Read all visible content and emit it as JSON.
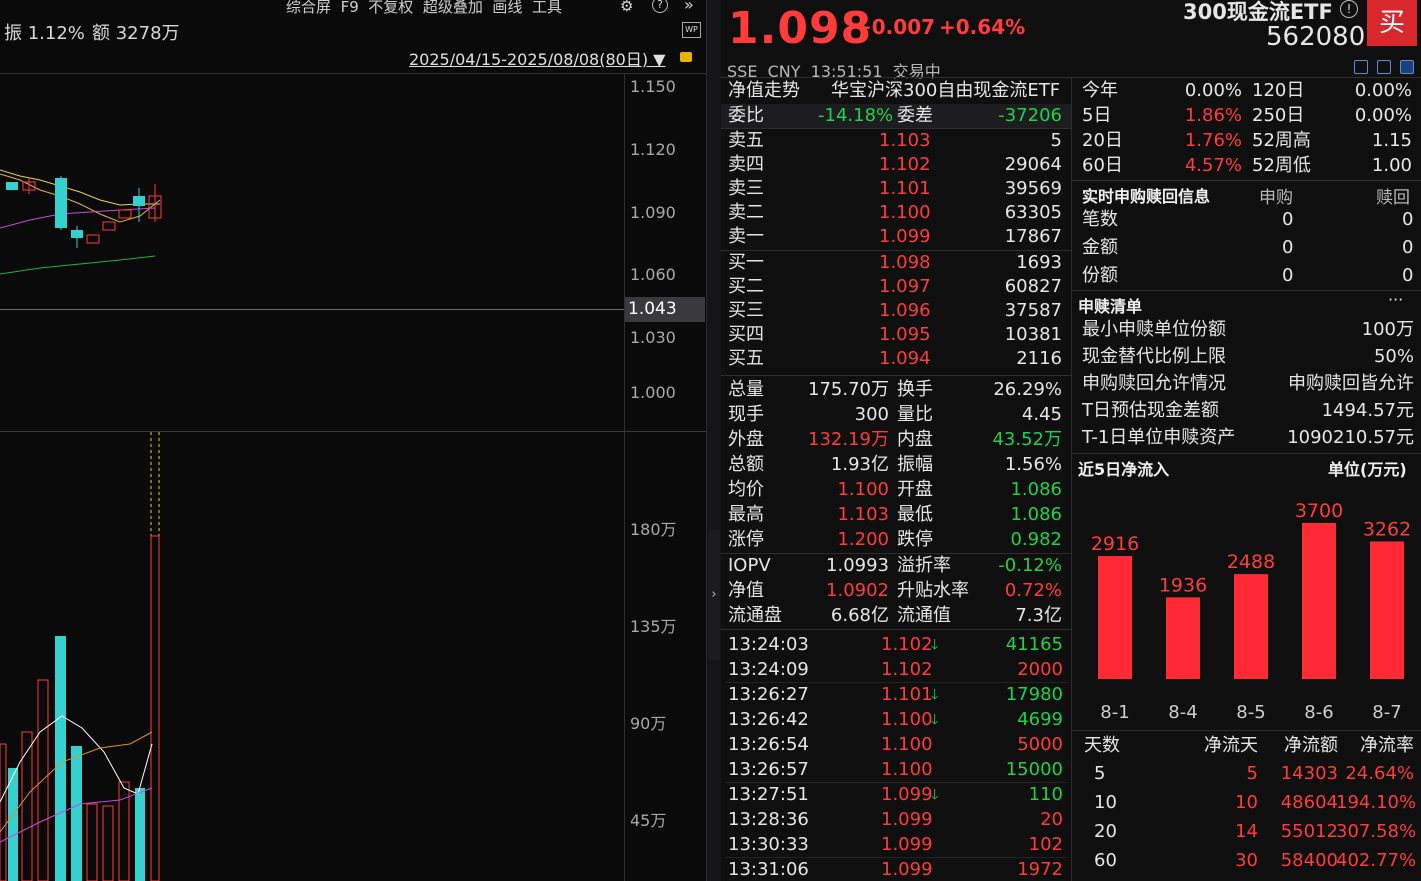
{
  "toolbar": {
    "items": [
      "综合屏",
      "F9",
      "不复权",
      "超级叠加",
      "画线",
      "工具"
    ],
    "amplitude": "振 1.12%",
    "amount": "额 3278万",
    "date_range": "2025/04/15-2025/08/08(80日)",
    "wp_label": "WP"
  },
  "price_axis": [
    "1.150",
    "1.120",
    "1.090",
    "1.060",
    "1.030",
    "1.000"
  ],
  "cursor_price": "1.043",
  "volume_axis": [
    "180万",
    "135万",
    "90万",
    "45万"
  ],
  "quote": {
    "price": "1.098",
    "change": "+0.007",
    "change_pct": "+0.64%",
    "name": "300现金流ETF",
    "code": "562080",
    "buy_label": "买",
    "exchange_line": "SSE  CNY  13:51:51  交易中"
  },
  "order_book": {
    "nav_trend_label": "净值走势",
    "fund_name": "华宝沪深300自由现金流ETF",
    "weibi_label": "委比",
    "weibi": "-14.18%",
    "weicha_label": "委差",
    "weicha": "-37206",
    "asks": [
      {
        "label": "卖五",
        "price": "1.103",
        "vol": "5"
      },
      {
        "label": "卖四",
        "price": "1.102",
        "vol": "29064"
      },
      {
        "label": "卖三",
        "price": "1.101",
        "vol": "39569"
      },
      {
        "label": "卖二",
        "price": "1.100",
        "vol": "63305"
      },
      {
        "label": "卖一",
        "price": "1.099",
        "vol": "17867"
      }
    ],
    "bids": [
      {
        "label": "买一",
        "price": "1.098",
        "vol": "1693"
      },
      {
        "label": "买二",
        "price": "1.097",
        "vol": "60827"
      },
      {
        "label": "买三",
        "price": "1.096",
        "vol": "37587"
      },
      {
        "label": "买四",
        "price": "1.095",
        "vol": "10381"
      },
      {
        "label": "买五",
        "price": "1.094",
        "vol": "2116"
      }
    ]
  },
  "stats": [
    {
      "l1": "总量",
      "v1": "175.70万",
      "c1": "white",
      "l2": "换手",
      "v2": "26.29%",
      "c2": "white"
    },
    {
      "l1": "现手",
      "v1": "300",
      "c1": "white",
      "l2": "量比",
      "v2": "4.45",
      "c2": "white"
    },
    {
      "l1": "外盘",
      "v1": "132.19万",
      "c1": "red",
      "l2": "内盘",
      "v2": "43.52万",
      "c2": "green"
    },
    {
      "l1": "总额",
      "v1": "1.93亿",
      "c1": "white",
      "l2": "振幅",
      "v2": "1.56%",
      "c2": "white"
    },
    {
      "l1": "均价",
      "v1": "1.100",
      "c1": "red",
      "l2": "开盘",
      "v2": "1.086",
      "c2": "green"
    },
    {
      "l1": "最高",
      "v1": "1.103",
      "c1": "red",
      "l2": "最低",
      "v2": "1.086",
      "c2": "green"
    },
    {
      "l1": "涨停",
      "v1": "1.200",
      "c1": "red",
      "l2": "跌停",
      "v2": "0.982",
      "c2": "green"
    }
  ],
  "stats2": [
    {
      "l1": "IOPV",
      "v1": "1.0993",
      "c1": "white",
      "l2": "溢折率",
      "v2": "-0.12%",
      "c2": "green"
    },
    {
      "l1": "净值",
      "v1": "1.0902",
      "c1": "red",
      "l2": "升贴水率",
      "v2": "0.72%",
      "c2": "red"
    },
    {
      "l1": "流通盘",
      "v1": "6.68亿",
      "c1": "white",
      "l2": "流通值",
      "v2": "7.3亿",
      "c2": "white"
    }
  ],
  "ticks": [
    {
      "time": "13:24:03",
      "price": "1.102",
      "vol": "41165",
      "down": true,
      "c": "green"
    },
    {
      "time": "13:24:09",
      "price": "1.102",
      "vol": "2000",
      "down": false,
      "c": "red"
    },
    {
      "time": "13:26:27",
      "price": "1.101",
      "vol": "17980",
      "down": true,
      "c": "green"
    },
    {
      "time": "13:26:42",
      "price": "1.100",
      "vol": "4699",
      "down": true,
      "c": "green"
    },
    {
      "time": "13:26:54",
      "price": "1.100",
      "vol": "5000",
      "down": false,
      "c": "red"
    },
    {
      "time": "13:26:57",
      "price": "1.100",
      "vol": "15000",
      "down": false,
      "c": "green"
    },
    {
      "time": "13:27:51",
      "price": "1.099",
      "vol": "110",
      "down": true,
      "c": "green"
    },
    {
      "time": "13:28:36",
      "price": "1.099",
      "vol": "20",
      "down": false,
      "c": "red"
    },
    {
      "time": "13:30:33",
      "price": "1.099",
      "vol": "102",
      "down": false,
      "c": "red"
    },
    {
      "time": "13:31:06",
      "price": "1.099",
      "vol": "1972",
      "down": false,
      "c": "red"
    }
  ],
  "performance": [
    {
      "l1": "今年",
      "v1": "0.00%",
      "c1": "white",
      "l2": "120日",
      "v2": "0.00%",
      "c2": "white"
    },
    {
      "l1": "5日",
      "v1": "1.86%",
      "c1": "red",
      "l2": "250日",
      "v2": "0.00%",
      "c2": "white"
    },
    {
      "l1": "20日",
      "v1": "1.76%",
      "c1": "red",
      "l2": "52周高",
      "v2": "1.15",
      "c2": "white"
    },
    {
      "l1": "60日",
      "v1": "4.57%",
      "c1": "red",
      "l2": "52周低",
      "v2": "1.00",
      "c2": "white"
    }
  ],
  "creation": {
    "title": "实时申购赎回信息",
    "col_sub": "申购",
    "col_red": "赎回",
    "rows": [
      {
        "label": "笔数",
        "sub": "0",
        "red": "0"
      },
      {
        "label": "金额",
        "sub": "0",
        "red": "0"
      },
      {
        "label": "份额",
        "sub": "0",
        "red": "0"
      }
    ]
  },
  "list": {
    "title": "申赎清单",
    "more": "···",
    "rows": [
      {
        "label": "最小申赎单位份额",
        "value": "100万"
      },
      {
        "label": "现金替代比例上限",
        "value": "50%"
      },
      {
        "label": "申购赎回允许情况",
        "value": "申购赎回皆允许"
      },
      {
        "label": "T日预估现金差额",
        "value": "1494.57元"
      },
      {
        "label": "T-1日单位申赎资产",
        "value": "1090210.57元"
      }
    ]
  },
  "inflow": {
    "title": "近5日净流入",
    "unit": "单位(万元)"
  },
  "chart_data": {
    "type": "bar",
    "title": "近5日净流入",
    "ylabel": "单位(万元)",
    "categories": [
      "8-1",
      "8-4",
      "8-5",
      "8-6",
      "8-7"
    ],
    "values": [
      2916,
      1936,
      2488,
      3700,
      3262
    ],
    "color": "#ff2a35"
  },
  "flow_table": {
    "headers": [
      "天数",
      "净流天",
      "净流额",
      "净流率"
    ],
    "rows": [
      [
        "5",
        "5",
        "14303",
        "24.64%"
      ],
      [
        "10",
        "10",
        "48604",
        "194.10%"
      ],
      [
        "20",
        "14",
        "55012",
        "307.58%"
      ],
      [
        "60",
        "30",
        "58400",
        "402.77%"
      ]
    ]
  },
  "colors": {
    "up": "#ff3b3b",
    "down": "#1fd24a",
    "volume_down": "#35d0d0",
    "bg": "#0f0f10"
  }
}
